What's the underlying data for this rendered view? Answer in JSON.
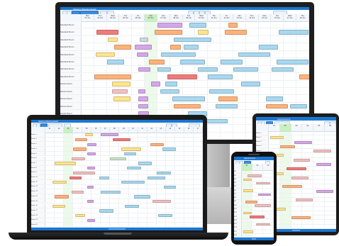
{
  "scene": "Responsive scheduler app shown on monitor, laptop, tablet and phone",
  "app": {
    "title": "Vacancy Planning board",
    "title_short": "Appointments",
    "accent": "#1976d2"
  },
  "monitor": {
    "days": [
      "Mon\n01 Jun",
      "Tue\n02 Jun",
      "Wed\n03 Jun",
      "Thu\n04 Jun",
      "Fri\n05 Jun",
      "Sat\n06 Jun",
      "Sun\n07 Jun",
      "Mon\n08 Jun",
      "Tue\n09 Jun",
      "Wed\n10 Jun",
      "Thu\n11 Jun",
      "Fri\n12 Jun",
      "Sat\n13 Jun",
      "Sun\n14 Jun",
      "Mon\n15 Jun",
      "Tue\n16 Jun",
      "Wed\n17 Jun",
      "Thu\n18 Jun"
    ],
    "rows": [
      "Standard Room",
      "Standard Room",
      "Standard Room",
      "Standard Room",
      "Standard Room",
      "Standard Room",
      "Standard Room",
      "Standard Room",
      "Deluxe Room",
      "Deluxe Room",
      "Deluxe Room",
      "Deluxe Room",
      "Family Room",
      "Family Room",
      "Family Room",
      "Family Room"
    ],
    "events": [
      {
        "row": 0,
        "start": 6.0,
        "len": 2.0,
        "color": "#d6a7e8"
      },
      {
        "row": 0,
        "start": 8.5,
        "len": 1.4,
        "color": "#a8d8f0"
      },
      {
        "row": 0,
        "start": 11.6,
        "len": 0.8,
        "color": "#ffb27a"
      },
      {
        "row": 1,
        "start": 1.2,
        "len": 1.8,
        "color": "#f07a7a"
      },
      {
        "row": 1,
        "start": 5.8,
        "len": 2.2,
        "color": "#ffb27a"
      },
      {
        "row": 1,
        "start": 9.2,
        "len": 0.9,
        "color": "#ffe48c"
      },
      {
        "row": 1,
        "start": 11.3,
        "len": 1.8,
        "color": "#ffb27a"
      },
      {
        "row": 1,
        "start": 15.6,
        "len": 2.4,
        "color": "#a8d8f0"
      },
      {
        "row": 2,
        "start": 2.1,
        "len": 0.8,
        "color": "#ffe48c"
      },
      {
        "row": 2,
        "start": 4.6,
        "len": 0.7,
        "color": "#cfd8e0"
      },
      {
        "row": 2,
        "start": 7.3,
        "len": 3.0,
        "color": "#a8d8f0"
      },
      {
        "row": 3,
        "start": 2.6,
        "len": 1.4,
        "color": "#ffb27a"
      },
      {
        "row": 3,
        "start": 4.2,
        "len": 1.4,
        "color": "#d6a7e8"
      },
      {
        "row": 3,
        "start": 7.0,
        "len": 0.9,
        "color": "#ffb27a"
      },
      {
        "row": 3,
        "start": 8.1,
        "len": 1.2,
        "color": "#a8d8f0"
      },
      {
        "row": 3,
        "start": 14.0,
        "len": 1.6,
        "color": "#a8d8f0"
      },
      {
        "row": 4,
        "start": 1.1,
        "len": 1.6,
        "color": "#ffe48c"
      },
      {
        "row": 4,
        "start": 4.4,
        "len": 0.9,
        "color": "#d6a7e8"
      },
      {
        "row": 4,
        "start": 6.3,
        "len": 2.8,
        "color": "#a8d8f0"
      },
      {
        "row": 4,
        "start": 12.4,
        "len": 2.6,
        "color": "#a8d8f0"
      },
      {
        "row": 5,
        "start": 2.0,
        "len": 1.4,
        "color": "#a8d8f0"
      },
      {
        "row": 5,
        "start": 5.3,
        "len": 1.3,
        "color": "#ffb27a"
      },
      {
        "row": 5,
        "start": 7.8,
        "len": 2.0,
        "color": "#a8d8f0"
      },
      {
        "row": 5,
        "start": 11.0,
        "len": 1.8,
        "color": "#a8d8f0"
      },
      {
        "row": 5,
        "start": 15.4,
        "len": 2.6,
        "color": "#a8d8f0"
      },
      {
        "row": 6,
        "start": 4.5,
        "len": 1.0,
        "color": "#d6a7e8"
      },
      {
        "row": 6,
        "start": 6.0,
        "len": 1.1,
        "color": "#a8d8f0"
      },
      {
        "row": 6,
        "start": 9.2,
        "len": 1.6,
        "color": "#a8d8f0"
      },
      {
        "row": 6,
        "start": 12.0,
        "len": 2.0,
        "color": "#a8d8f0"
      },
      {
        "row": 6,
        "start": 15.0,
        "len": 1.8,
        "color": "#a8d8f0"
      },
      {
        "row": 7,
        "start": 1.0,
        "len": 3.0,
        "color": "#ffb27a"
      },
      {
        "row": 7,
        "start": 6.8,
        "len": 2.4,
        "color": "#f07a7a"
      },
      {
        "row": 7,
        "start": 10.0,
        "len": 2.0,
        "color": "#a8d8f0"
      },
      {
        "row": 7,
        "start": 17.2,
        "len": 1.4,
        "color": "#ffb27a"
      },
      {
        "row": 8,
        "start": 2.4,
        "len": 1.5,
        "color": "#ffe48c"
      },
      {
        "row": 8,
        "start": 5.5,
        "len": 0.8,
        "color": "#d6a7e8"
      },
      {
        "row": 8,
        "start": 6.6,
        "len": 1.0,
        "color": "#a8d8f0"
      },
      {
        "row": 8,
        "start": 12.6,
        "len": 1.6,
        "color": "#a8d8f0"
      },
      {
        "row": 9,
        "start": 2.4,
        "len": 1.3,
        "color": "#f5c0c0"
      },
      {
        "row": 9,
        "start": 4.5,
        "len": 0.6,
        "color": "#d6a7e8"
      },
      {
        "row": 9,
        "start": 6.2,
        "len": 1.6,
        "color": "#a8d8f0"
      },
      {
        "row": 9,
        "start": 10.1,
        "len": 2.0,
        "color": "#a8d8f0"
      },
      {
        "row": 10,
        "start": 2.5,
        "len": 1.4,
        "color": "#ffe48c"
      },
      {
        "row": 10,
        "start": 4.5,
        "len": 0.8,
        "color": "#d6a7e8"
      },
      {
        "row": 10,
        "start": 7.2,
        "len": 2.6,
        "color": "#a8d8f0"
      },
      {
        "row": 10,
        "start": 10.8,
        "len": 1.6,
        "color": "#ffb27a"
      },
      {
        "row": 10,
        "start": 14.6,
        "len": 1.4,
        "color": "#a8d8f0"
      },
      {
        "row": 11,
        "start": 4.5,
        "len": 0.8,
        "color": "#d6a7e8"
      },
      {
        "row": 11,
        "start": 7.3,
        "len": 2.2,
        "color": "#ffb27a"
      },
      {
        "row": 11,
        "start": 10.6,
        "len": 1.8,
        "color": "#a8d8f0"
      },
      {
        "row": 11,
        "start": 14.6,
        "len": 1.8,
        "color": "#ffb27a"
      },
      {
        "row": 11,
        "start": 16.5,
        "len": 1.4,
        "color": "#a8d8f0"
      },
      {
        "row": 12,
        "start": 4.5,
        "len": 0.9,
        "color": "#d6a7e8"
      },
      {
        "row": 12,
        "start": 8.4,
        "len": 1.6,
        "color": "#a8d8f0"
      },
      {
        "row": 13,
        "start": 4.6,
        "len": 0.9,
        "color": "#d6a7e8"
      },
      {
        "row": 13,
        "start": 6.9,
        "len": 2.6,
        "color": "#a8d8f0"
      },
      {
        "row": 13,
        "start": 9.6,
        "len": 2.0,
        "color": "#a8d8f0"
      },
      {
        "row": 14,
        "start": 3.0,
        "len": 1.2,
        "color": "#a8d8f0"
      },
      {
        "row": 15,
        "start": 4.5,
        "len": 0.8,
        "color": "#d6a7e8"
      }
    ]
  },
  "laptop": {
    "days": [
      "01",
      "02",
      "03",
      "04",
      "05",
      "06",
      "07",
      "08",
      "09",
      "10",
      "11",
      "12",
      "13",
      "14",
      "15",
      "16",
      "17"
    ],
    "rows": [
      "Room 1",
      "Room 2",
      "Room 3",
      "Room 4",
      "Room 5",
      "Room 6",
      "Room 7",
      "Room 8",
      "Room 9",
      "Room 10",
      "Room 11",
      "Room 12",
      "Room 13",
      "Room 14",
      "Room 15",
      "Room 16",
      "Room 17",
      "Room 18",
      "Room 19",
      "Room 20"
    ],
    "events": [
      {
        "row": 0,
        "start": 4.3,
        "len": 0.9,
        "color": "#ffe48c"
      },
      {
        "row": 0,
        "start": 6.0,
        "len": 2.0,
        "color": "#d6a7e8"
      },
      {
        "row": 1,
        "start": 3.2,
        "len": 1.4,
        "color": "#ffb27a"
      },
      {
        "row": 1,
        "start": 7.3,
        "len": 2.0,
        "color": "#f07a7a"
      },
      {
        "row": 2,
        "start": 4.5,
        "len": 1.1,
        "color": "#d6a7e8"
      },
      {
        "row": 2,
        "start": 11.3,
        "len": 1.6,
        "color": "#ffb27a"
      },
      {
        "row": 3,
        "start": 3.0,
        "len": 1.5,
        "color": "#ffb27a"
      },
      {
        "row": 3,
        "start": 8.2,
        "len": 2.2,
        "color": "#ffe48c"
      },
      {
        "row": 3,
        "start": 12.6,
        "len": 1.6,
        "color": "#a8d8f0"
      },
      {
        "row": 4,
        "start": 4.5,
        "len": 1.0,
        "color": "#d6a7e8"
      },
      {
        "row": 4,
        "start": 8.5,
        "len": 1.4,
        "color": "#a8d8f0"
      },
      {
        "row": 5,
        "start": 2.8,
        "len": 1.6,
        "color": "#f5c0c0"
      },
      {
        "row": 5,
        "start": 7.0,
        "len": 1.8,
        "color": "#c8e6c9"
      },
      {
        "row": 6,
        "start": 1.0,
        "len": 2.4,
        "color": "#ffe48c"
      },
      {
        "row": 6,
        "start": 10.0,
        "len": 1.6,
        "color": "#a8d8f0"
      },
      {
        "row": 7,
        "start": 4.5,
        "len": 0.9,
        "color": "#d6a7e8"
      },
      {
        "row": 7,
        "start": 8.8,
        "len": 1.6,
        "color": "#a8d8f0"
      },
      {
        "row": 8,
        "start": 3.0,
        "len": 2.4,
        "color": "#f5c0c0"
      },
      {
        "row": 8,
        "start": 12.0,
        "len": 1.6,
        "color": "#a8d8f0"
      },
      {
        "row": 9,
        "start": 2.6,
        "len": 1.4,
        "color": "#f07a7a"
      },
      {
        "row": 9,
        "start": 5.8,
        "len": 1.2,
        "color": "#a8d8f0"
      },
      {
        "row": 9,
        "start": 11.0,
        "len": 2.0,
        "color": "#a8d8f0"
      },
      {
        "row": 10,
        "start": 0.8,
        "len": 1.6,
        "color": "#ffe48c"
      },
      {
        "row": 10,
        "start": 8.2,
        "len": 2.6,
        "color": "#a8d8f0"
      },
      {
        "row": 11,
        "start": 4.5,
        "len": 0.8,
        "color": "#d6a7e8"
      },
      {
        "row": 11,
        "start": 12.8,
        "len": 1.4,
        "color": "#a8d8f0"
      },
      {
        "row": 12,
        "start": 2.8,
        "len": 1.4,
        "color": "#f5c0c0"
      },
      {
        "row": 12,
        "start": 6.0,
        "len": 2.2,
        "color": "#a8d8f0"
      },
      {
        "row": 13,
        "start": 1.0,
        "len": 1.6,
        "color": "#ffb27a"
      },
      {
        "row": 13,
        "start": 9.6,
        "len": 1.8,
        "color": "#a8d8f0"
      },
      {
        "row": 14,
        "start": 4.5,
        "len": 0.8,
        "color": "#d6a7e8"
      },
      {
        "row": 14,
        "start": 11.6,
        "len": 2.0,
        "color": "#f5c0c0"
      },
      {
        "row": 15,
        "start": 0.8,
        "len": 1.4,
        "color": "#ffe48c"
      },
      {
        "row": 15,
        "start": 8.6,
        "len": 1.6,
        "color": "#a8d8f0"
      },
      {
        "row": 16,
        "start": 5.8,
        "len": 1.6,
        "color": "#a8d8f0"
      },
      {
        "row": 17,
        "start": 3.2,
        "len": 1.2,
        "color": "#ffe48c"
      },
      {
        "row": 17,
        "start": 12.2,
        "len": 1.6,
        "color": "#a8d8f0"
      },
      {
        "row": 18,
        "start": 4.5,
        "len": 0.9,
        "color": "#d6a7e8"
      }
    ]
  },
  "tablet": {
    "days": [
      "01",
      "02",
      "03",
      "04",
      "05",
      "06"
    ],
    "rows": [
      "Room 1",
      "Room 2",
      "Room 3",
      "Room 4",
      "Room 5",
      "Room 6",
      "Room 7",
      "Room 8",
      "Room 9",
      "Room 10",
      "Room 11",
      "Room 12",
      "Room 13",
      "Room 14",
      "Room 15",
      "Room 16",
      "Room 17",
      "Room 18",
      "Room 19",
      "Room 20",
      "Room 21",
      "Room 22"
    ],
    "events": [
      {
        "row": 1,
        "start": 0.1,
        "len": 1.3,
        "color": "#ffe48c"
      },
      {
        "row": 2,
        "start": 2.3,
        "len": 1.6,
        "color": "#d6a7e8"
      },
      {
        "row": 3,
        "start": 1.0,
        "len": 1.4,
        "color": "#ffb27a"
      },
      {
        "row": 4,
        "start": 4.0,
        "len": 1.6,
        "color": "#f5c0c0"
      },
      {
        "row": 5,
        "start": 0.2,
        "len": 1.2,
        "color": "#ffe48c"
      },
      {
        "row": 6,
        "start": 2.2,
        "len": 1.5,
        "color": "#f5c0c0"
      },
      {
        "row": 7,
        "start": 4.2,
        "len": 1.4,
        "color": "#d6a7e8"
      },
      {
        "row": 8,
        "start": 1.6,
        "len": 1.8,
        "color": "#f07a7a"
      },
      {
        "row": 9,
        "start": 0.2,
        "len": 1.2,
        "color": "#ffe48c"
      },
      {
        "row": 10,
        "start": 2.0,
        "len": 1.6,
        "color": "#f5c0c0"
      },
      {
        "row": 12,
        "start": 1.2,
        "len": 1.8,
        "color": "#ffb27a"
      },
      {
        "row": 13,
        "start": 4.2,
        "len": 1.6,
        "color": "#d6a7e8"
      },
      {
        "row": 15,
        "start": 2.4,
        "len": 1.6,
        "color": "#f5c0c0"
      },
      {
        "row": 17,
        "start": 0.3,
        "len": 1.3,
        "color": "#ffe48c"
      },
      {
        "row": 19,
        "start": 2.0,
        "len": 1.8,
        "color": "#ffb27a"
      }
    ]
  },
  "phone": {
    "days": [
      "01",
      "02",
      "03"
    ],
    "rows": [
      "R1",
      "R2",
      "R3",
      "R4",
      "R5",
      "R6",
      "R7",
      "R8",
      "R9",
      "R10",
      "R11",
      "R12",
      "R13",
      "R14",
      "R15",
      "R16",
      "R17",
      "R18"
    ],
    "events": [
      {
        "row": 1,
        "start": 0.5,
        "len": 1.4,
        "color": "#f5c0c0"
      },
      {
        "row": 2,
        "start": 0.1,
        "len": 0.9,
        "color": "#ffe48c"
      },
      {
        "row": 3,
        "start": 1.3,
        "len": 1.4,
        "color": "#f5c0c0"
      },
      {
        "row": 5,
        "start": 0.1,
        "len": 1.0,
        "color": "#ffe48c"
      },
      {
        "row": 6,
        "start": 1.5,
        "len": 1.3,
        "color": "#d6a7e8"
      },
      {
        "row": 8,
        "start": 0.3,
        "len": 1.2,
        "color": "#ffb27a"
      },
      {
        "row": 9,
        "start": 1.2,
        "len": 1.6,
        "color": "#f5c0c0"
      },
      {
        "row": 11,
        "start": 0.1,
        "len": 0.9,
        "color": "#ffe48c"
      },
      {
        "row": 12,
        "start": 0.7,
        "len": 1.5,
        "color": "#f07a7a"
      },
      {
        "row": 14,
        "start": 1.3,
        "len": 1.4,
        "color": "#f5c0c0"
      },
      {
        "row": 16,
        "start": 0.1,
        "len": 1.0,
        "color": "#ffe48c"
      }
    ]
  }
}
